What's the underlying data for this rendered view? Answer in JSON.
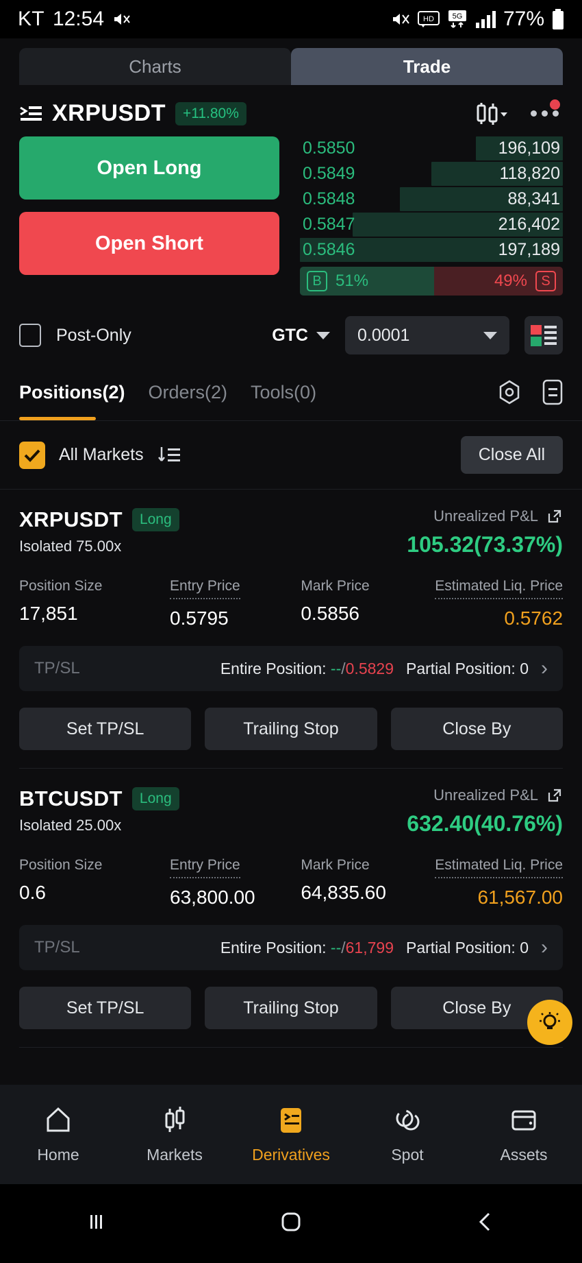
{
  "status_bar": {
    "carrier": "KT",
    "time": "12:54",
    "battery": "77%",
    "icons": [
      "speaker-mute-icon",
      "hd-icon",
      "5g-icon",
      "signal-bars-icon",
      "battery-icon"
    ]
  },
  "top_tabs": [
    {
      "label": "Charts",
      "active": false
    },
    {
      "label": "Trade",
      "active": true
    }
  ],
  "symbol_header": {
    "icon": "list-detail-icon",
    "symbol": "XRPUSDT",
    "change_pct": "+11.80%",
    "change_color": "#26c281",
    "chart_icon": "candlestick-icon",
    "more_icon": "more-dots-icon"
  },
  "order_buttons": {
    "long": "Open Long",
    "short": "Open Short",
    "long_color": "#26a96c",
    "short_color": "#f0484f"
  },
  "order_book": {
    "rows": [
      {
        "price": "0.5850",
        "qty": "196,109",
        "depth": 33
      },
      {
        "price": "0.5849",
        "qty": "118,820",
        "depth": 50
      },
      {
        "price": "0.5848",
        "qty": "88,341",
        "depth": 62
      },
      {
        "price": "0.5847",
        "qty": "216,402",
        "depth": 80
      },
      {
        "price": "0.5846",
        "qty": "197,189",
        "depth": 100
      }
    ],
    "ratio": {
      "buy_tag": "B",
      "buy_pct": "51%",
      "sell_pct": "49%",
      "sell_tag": "S"
    }
  },
  "order_settings": {
    "post_only_label": "Post-Only",
    "post_only_checked": false,
    "time_in_force": "GTC",
    "tick_size": "0.0001",
    "book_layout_icon": "orderbook-layout-icon"
  },
  "position_tabs": [
    {
      "label": "Positions(2)",
      "active": true
    },
    {
      "label": "Orders(2)",
      "active": false
    },
    {
      "label": "Tools(0)",
      "active": false
    }
  ],
  "position_tab_icons": [
    "target-icon",
    "document-list-icon"
  ],
  "filter_row": {
    "all_markets_label": "All Markets",
    "all_markets_checked": true,
    "sort_icon": "sort-descending-icon",
    "close_all_label": "Close All"
  },
  "metric_labels": {
    "position_size": "Position Size",
    "entry_price": "Entry Price",
    "mark_price": "Mark Price",
    "liq_price": "Estimated Liq. Price"
  },
  "tpsl_labels": {
    "title": "TP/SL",
    "entire": "Entire Position:",
    "partial": "Partial Position:"
  },
  "action_labels": {
    "set_tpsl": "Set TP/SL",
    "trailing_stop": "Trailing Stop",
    "close_by": "Close By"
  },
  "pnl_label": "Unrealized P&L",
  "positions": [
    {
      "symbol": "XRPUSDT",
      "side": "Long",
      "margin_mode": "Isolated 75.00x",
      "pnl": "105.32(73.37%)",
      "position_size": "17,851",
      "entry_price": "0.5795",
      "mark_price": "0.5856",
      "liq_price": "0.5762",
      "tp": "--",
      "sl": "0.5829",
      "partial": "0"
    },
    {
      "symbol": "BTCUSDT",
      "side": "Long",
      "margin_mode": "Isolated 25.00x",
      "pnl": "632.40(40.76%)",
      "position_size": "0.6",
      "entry_price": "63,800.00",
      "mark_price": "64,835.60",
      "liq_price": "61,567.00",
      "tp": "--",
      "sl": "61,799",
      "partial": "0"
    }
  ],
  "fab": {
    "icon": "lightbulb-icon",
    "color": "#f5b31c"
  },
  "bottom_nav": [
    {
      "label": "Home",
      "icon": "home-icon",
      "active": false
    },
    {
      "label": "Markets",
      "icon": "candlestick-icon",
      "active": false
    },
    {
      "label": "Derivatives",
      "icon": "derivatives-icon",
      "active": true
    },
    {
      "label": "Spot",
      "icon": "spot-swap-icon",
      "active": false
    },
    {
      "label": "Assets",
      "icon": "wallet-icon",
      "active": false
    }
  ],
  "system_nav": [
    "recents-icon",
    "home-circle-icon",
    "back-icon"
  ]
}
